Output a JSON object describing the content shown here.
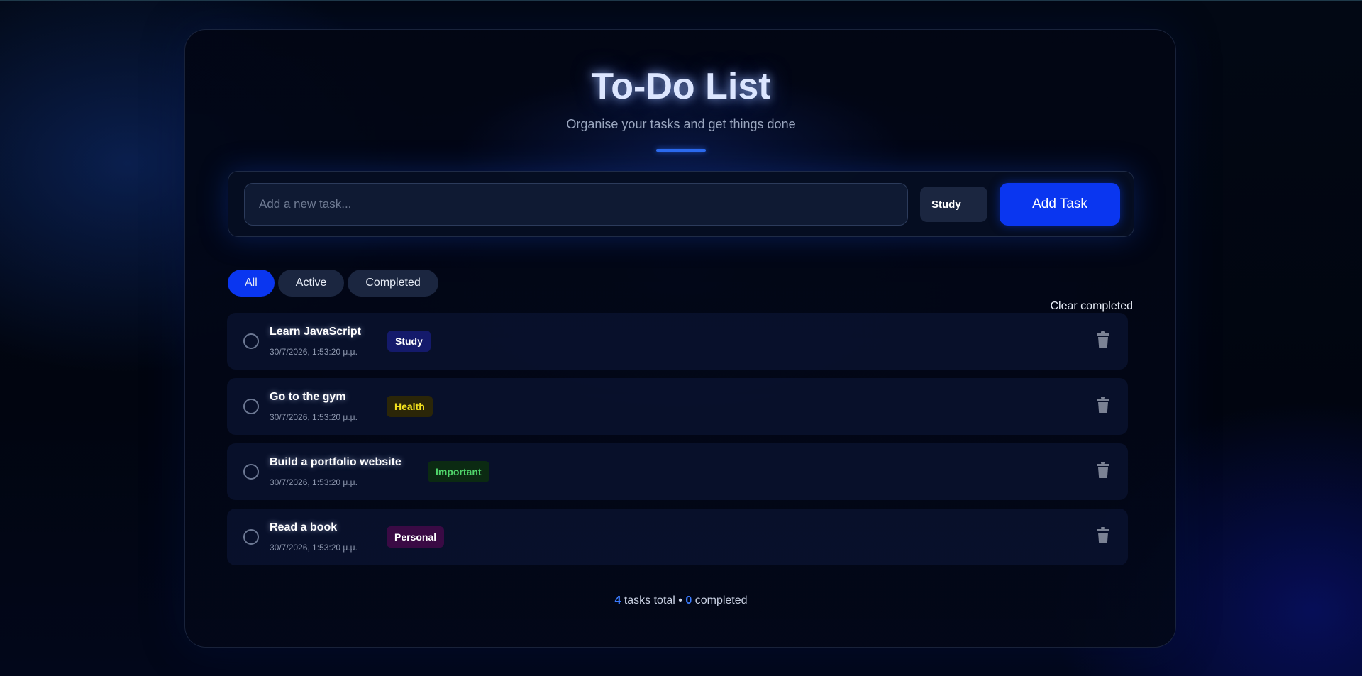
{
  "header": {
    "title": "To-Do List",
    "subtitle": "Organise your tasks and get things done"
  },
  "input": {
    "placeholder": "Add a new task...",
    "value": "",
    "category_selected": "Study",
    "add_label": "Add Task"
  },
  "filters": {
    "items": [
      {
        "label": "All",
        "active": true
      },
      {
        "label": "Active",
        "active": false
      },
      {
        "label": "Completed",
        "active": false
      }
    ],
    "clear_label": "Clear completed"
  },
  "tasks": [
    {
      "text": "Learn JavaScript",
      "date": "30/7/2026, 1:53:20 μ.μ.",
      "tag": "Study",
      "completed": false
    },
    {
      "text": "Go to the gym",
      "date": "30/7/2026, 1:53:20 μ.μ.",
      "tag": "Health",
      "completed": false
    },
    {
      "text": "Build a portfolio website",
      "date": "30/7/2026, 1:53:20 μ.μ.",
      "tag": "Important",
      "completed": false
    },
    {
      "text": "Read a book",
      "date": "30/7/2026, 1:53:20 μ.μ.",
      "tag": "Personal",
      "completed": false
    }
  ],
  "tag_colors": {
    "Study": {
      "bg": "#141a6b",
      "fg": "#ffffff"
    },
    "Health": {
      "bg": "#2b2608",
      "fg": "#f4e21e"
    },
    "Important": {
      "bg": "#0b2a12",
      "fg": "#4fd46a"
    },
    "Personal": {
      "bg": "#3a0a44",
      "fg": "#ffffff"
    }
  },
  "footer": {
    "total": "4",
    "total_label": "tasks total",
    "separator": "•",
    "completed": "0",
    "completed_label": "completed"
  },
  "icons": {
    "delete": "trash-icon",
    "check": "circle-check-icon"
  },
  "colors": {
    "accent": "#0a36f0",
    "highlight_number": "#3b7cff"
  }
}
